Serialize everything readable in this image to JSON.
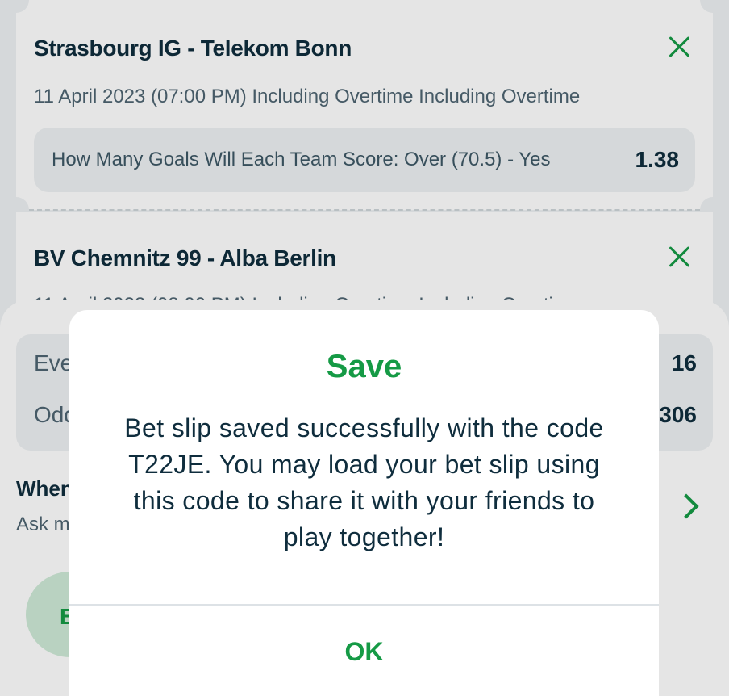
{
  "bets": [
    {
      "match": "Strasbourg IG - Telekom Bonn",
      "date": "11 April 2023 (07:00 PM) Including Overtime Including Overtime",
      "selection": "How Many Goals Will Each Team Score: Over (70.5) - Yes",
      "odds": "1.38"
    },
    {
      "match": "BV Chemnitz 99 - Alba Berlin",
      "date": "11 April 2023 (08:00 PM) Including Overtime Including Overtime"
    }
  ],
  "summary": {
    "events_label": "Eve",
    "events_value": "16",
    "odds_label": "Odd",
    "odds_value": "306"
  },
  "odds_change": {
    "title": "When",
    "subtitle": "Ask m"
  },
  "round_action_label": "B",
  "dialog": {
    "title": "Save",
    "message": "Bet slip saved successfully with the code T22JE. You may load your bet slip using this code to share it with your friends to play together!",
    "ok_label": "OK"
  },
  "colors": {
    "accent": "#159a45",
    "text_dark": "#0f2d3d",
    "text_muted": "#4e6572",
    "surface": "#eef1f3"
  }
}
